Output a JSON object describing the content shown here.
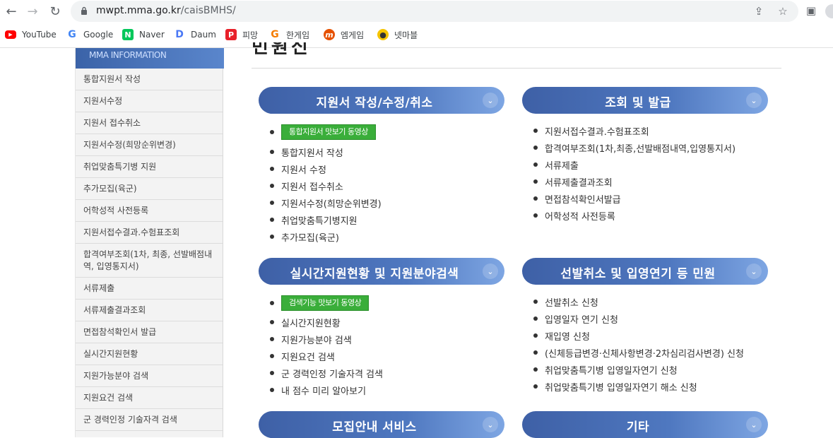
{
  "browser": {
    "url_host": "mwpt.mma.go.kr",
    "url_path": "/caisBMHS/",
    "bookmarks": [
      {
        "label": "YouTube",
        "icon": "youtube-icon",
        "color": "#ff0000"
      },
      {
        "label": "Google",
        "icon": "google-icon",
        "color": "#4285f4"
      },
      {
        "label": "Naver",
        "icon": "naver-icon",
        "color": "#03c75a"
      },
      {
        "label": "Daum",
        "icon": "daum-icon",
        "color": "#4a78f5"
      },
      {
        "label": "피망",
        "icon": "pmang-icon",
        "color": "#e8202a"
      },
      {
        "label": "한게임",
        "icon": "hangame-icon",
        "color": "#f57c00"
      },
      {
        "label": "엠게임",
        "icon": "mgame-icon",
        "color": "#e65100"
      },
      {
        "label": "넷마블",
        "icon": "netmarble-icon",
        "color": "#f5c400"
      }
    ]
  },
  "sidebar": {
    "header": "MMA INFORMATION",
    "items": [
      "통합지원서 작성",
      "지원서수정",
      "지원서 접수취소",
      "지원서수정(희망순위변경)",
      "취업맞춤특기병 지원",
      "추가모집(육군)",
      "어학성적 사전등록",
      "지원서접수결과.수험표조회",
      "합격여부조회(1차, 최종, 선발배점내역, 입영통지서)",
      "서류제출",
      "서류제출결과조회",
      "면접참석확인서 발급",
      "실시간지원현황",
      "지원가능분야 검색",
      "지원요건 검색",
      "군 경력인정 기술자격 검색"
    ]
  },
  "main": {
    "page_title_fragment": "민원신청",
    "sections": [
      {
        "title": "지원서 작성/수정/취소",
        "video_button": "통합지원서 맛보기 동영상",
        "items": [
          "통합지원서 작성",
          "지원서 수정",
          "지원서 접수취소",
          "지원서수정(희망순위변경)",
          "취업맞춤특기병지원",
          "추가모집(육군)"
        ]
      },
      {
        "title": "조회 및 발급",
        "items": [
          "지원서접수결과.수험표조회",
          "합격여부조회(1차,최종,선발배점내역,입영통지서)",
          "서류제출",
          "서류제출결과조회",
          "면접참석확인서발급",
          "어학성적 사전등록"
        ]
      },
      {
        "title": "실시간지원현황 및 지원분야검색",
        "video_button": "검색기능 맛보기 동영상",
        "items": [
          "실시간지원현황",
          "지원가능분야 검색",
          "지원요건 검색",
          "군 경력인정 기술자격 검색",
          "내 점수 미리 알아보기"
        ]
      },
      {
        "title": "선발취소 및 입영연기 등 민원",
        "items": [
          "선발취소 신청",
          "입영일자 연기 신청",
          "재입영 신청",
          "(신체등급변경·신체사항변경·2차심리검사변경) 신청",
          "취업맞춤특기병 입영일자연기 신청",
          "취업맞춤특기병 입영일자연기 해소 신청"
        ]
      },
      {
        "title": "모집안내 서비스"
      },
      {
        "title": "기타"
      }
    ]
  },
  "colors": {
    "pill": "#4a6fb5",
    "video_button": "#3aae3a",
    "sidebar_header": "#3b63a8"
  }
}
